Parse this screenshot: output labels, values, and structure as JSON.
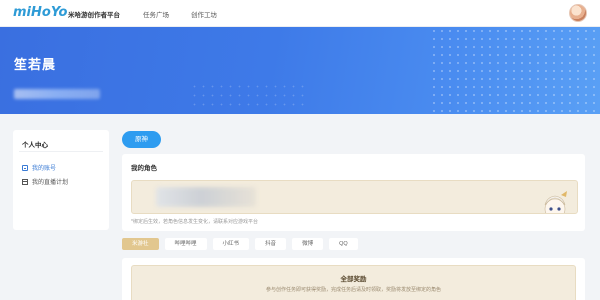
{
  "header": {
    "logo_text": "miHoYo",
    "platform_name": "米哈游创作者平台",
    "nav": [
      {
        "label": "任务广场"
      },
      {
        "label": "创作工坊"
      }
    ]
  },
  "banner": {
    "username": "笙若晨"
  },
  "sidebar": {
    "title": "个人中心",
    "items": [
      {
        "label": "我的账号",
        "active": true,
        "icon": "profile-icon"
      },
      {
        "label": "我的直播计划",
        "active": false,
        "icon": "calendar-icon"
      }
    ]
  },
  "main": {
    "pill_button": "原神",
    "bound_role_title": "我的角色",
    "note": "*绑定后生效，若角色信息发生变化，请联系对应游戏平台"
  },
  "tabs": [
    {
      "label": "米游社",
      "active": true
    },
    {
      "label": "哔哩哔哩",
      "active": false
    },
    {
      "label": "小红书",
      "active": false
    },
    {
      "label": "抖音",
      "active": false
    },
    {
      "label": "微博",
      "active": false
    },
    {
      "label": "QQ",
      "active": false
    }
  ],
  "reward": {
    "title": "全部奖励",
    "subtitle": "参与创作任务即可获得奖励，完成任务后请及时领取，奖励将发放至绑定的角色"
  },
  "colors": {
    "accent": "#2e9cf0",
    "banner": "#3e7ae8",
    "tab_active": "#e2c78f",
    "panel_beige": "#f3ecdd"
  }
}
